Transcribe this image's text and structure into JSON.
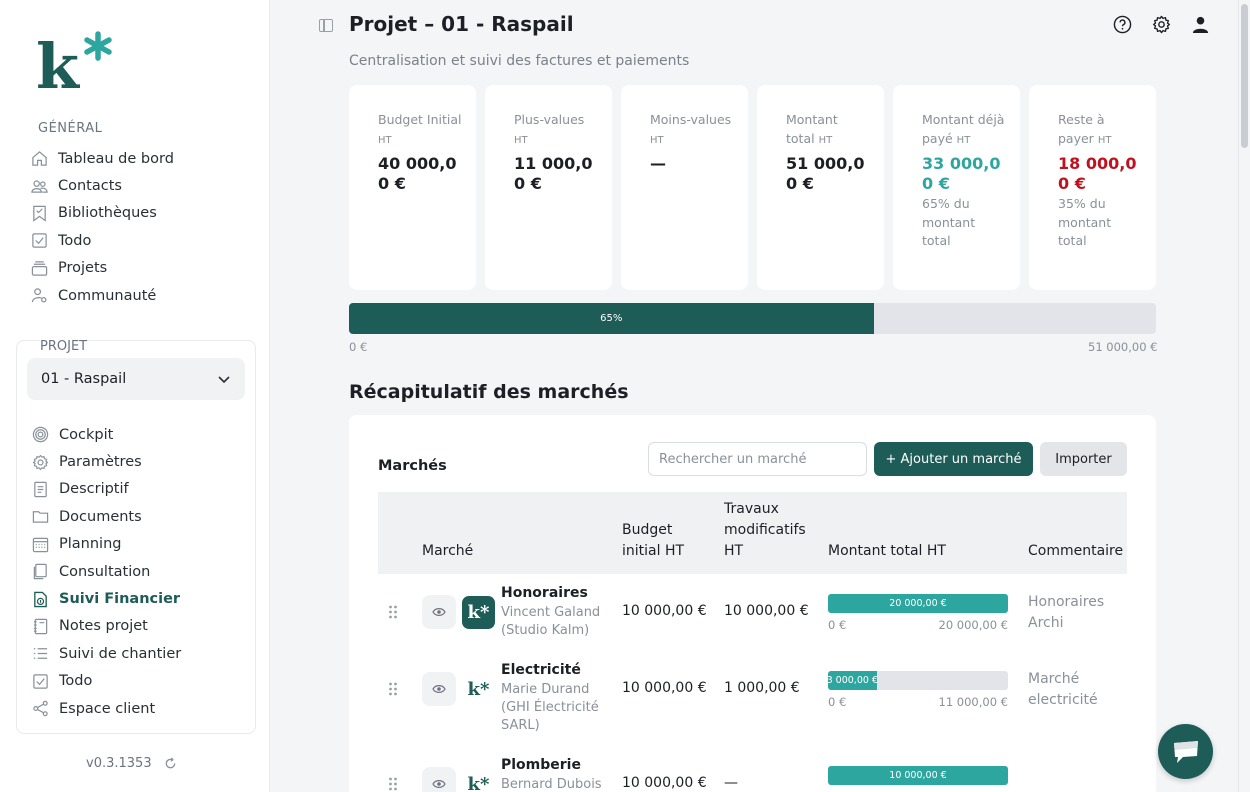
{
  "brand": {
    "logo_text": "k*",
    "accent": "#1d5c57",
    "teal": "#2ea6a0",
    "danger": "#c0111f"
  },
  "sidebar": {
    "general_title": "GÉNÉRAL",
    "general_items": [
      {
        "label": "Tableau de bord",
        "icon": "home-icon"
      },
      {
        "label": "Contacts",
        "icon": "users-icon"
      },
      {
        "label": "Bibliothèques",
        "icon": "bookmark-icon"
      },
      {
        "label": "Todo",
        "icon": "check-square-icon"
      },
      {
        "label": "Projets",
        "icon": "layers-icon"
      },
      {
        "label": "Communauté",
        "icon": "user-gear-icon"
      }
    ],
    "project_title": "PROJET",
    "project_select": "01 - Raspail",
    "project_items": [
      {
        "label": "Cockpit",
        "icon": "target-icon"
      },
      {
        "label": "Paramètres",
        "icon": "gear-icon"
      },
      {
        "label": "Descriptif",
        "icon": "document-icon"
      },
      {
        "label": "Documents",
        "icon": "folder-icon"
      },
      {
        "label": "Planning",
        "icon": "calendar-icon"
      },
      {
        "label": "Consultation",
        "icon": "files-icon"
      },
      {
        "label": "Suivi Financier",
        "icon": "money-doc-icon",
        "active": true
      },
      {
        "label": "Notes projet",
        "icon": "notebook-icon"
      },
      {
        "label": "Suivi de chantier",
        "icon": "list-icon"
      },
      {
        "label": "Todo",
        "icon": "check-square-icon"
      },
      {
        "label": "Espace client",
        "icon": "share-icon"
      }
    ],
    "version": "v0.3.1353"
  },
  "header": {
    "title": "Projet – 01 - Raspail",
    "subtitle": "Centralisation et suivi des factures et paiements"
  },
  "cards": [
    {
      "label": "Budget Initial",
      "unit": "HT",
      "value": "40 000,00 €",
      "style": "",
      "note": ""
    },
    {
      "label": "Plus-values",
      "unit": "HT",
      "value": "11 000,00 €",
      "style": "",
      "note": ""
    },
    {
      "label": "Moins-values",
      "unit": "HT",
      "value": "—",
      "style": "",
      "note": ""
    },
    {
      "label": "Montant total",
      "unit": "HT",
      "value": "51 000,00 €",
      "style": "",
      "note": ""
    },
    {
      "label": "Montant déjà payé",
      "unit": "HT",
      "value": "33 000,00 €",
      "style": "green",
      "note": "65% du montant total"
    },
    {
      "label": "Reste à payer",
      "unit": "HT",
      "value": "18 000,00 €",
      "style": "red",
      "note": "35% du montant total"
    }
  ],
  "progress": {
    "value": 0.65,
    "label": "65%",
    "min_label": "0 €",
    "max_label": "51 000,00 €"
  },
  "recap": {
    "title": "Récapitulatif des marchés",
    "table_title": "Marchés",
    "search_placeholder": "Rechercher un marché",
    "add_button": "+ Ajouter un marché",
    "import_button": "Importer",
    "columns": [
      "Marché",
      "Budget initial HT",
      "Travaux modificatifs HT",
      "Montant total HT",
      "Commentaire"
    ],
    "rows": [
      {
        "name": "Honoraires",
        "contact": "Vincent Galand (Studio Kalm)",
        "logo": "dark",
        "budget": "10 000,00 €",
        "travaux": "10 000,00 €",
        "fill": 1.0,
        "bar_label": "20 000,00 €",
        "min": "0 €",
        "max": "20 000,00 €",
        "comment": "Honoraires Archi"
      },
      {
        "name": "Electricité",
        "contact": "Marie Durand (GHI Électricité SARL)",
        "logo": "light",
        "budget": "10 000,00 €",
        "travaux": "1 000,00 €",
        "fill": 0.27,
        "bar_label": "3 000,00 €",
        "min": "0 €",
        "max": "11 000,00 €",
        "comment": "Marché electricité"
      },
      {
        "name": "Plomberie",
        "contact": "Bernard Dubois",
        "logo": "light",
        "budget": "10 000,00 €",
        "travaux": "—",
        "fill": 1.0,
        "bar_label": "10 000,00 €",
        "min": "",
        "max": "",
        "comment": ""
      }
    ]
  }
}
